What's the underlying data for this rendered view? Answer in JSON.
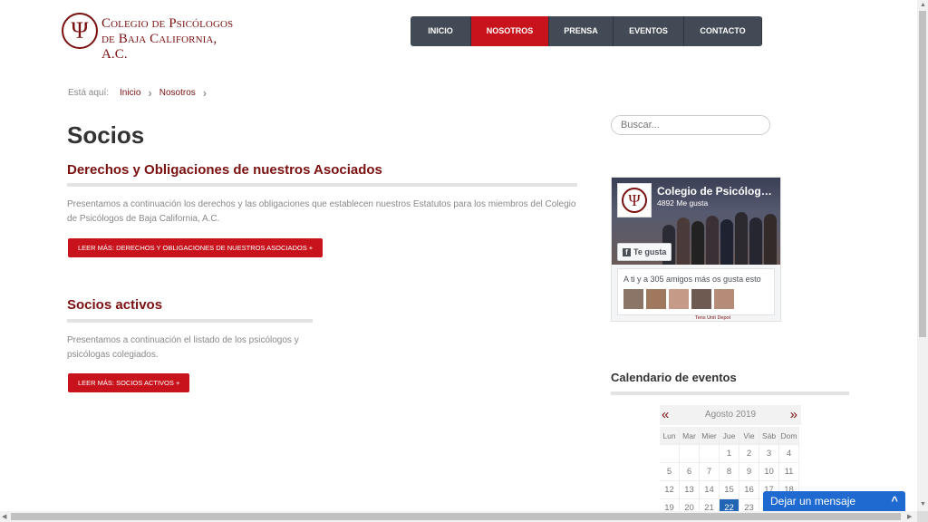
{
  "logo": {
    "mark": "Ψ",
    "line1": "Colegio de Psicólogos",
    "line2": "de Baja California, A.C."
  },
  "nav": [
    {
      "label": "INICIO",
      "active": false
    },
    {
      "label": "NOSOTROS",
      "active": true
    },
    {
      "label": "PRENSA",
      "active": false
    },
    {
      "label": "EVENTOS",
      "active": false
    },
    {
      "label": "CONTACTO",
      "active": false
    }
  ],
  "breadcrumb": {
    "prefix": "Está aquí:",
    "items": [
      "Inicio",
      "Nosotros"
    ]
  },
  "page_title": "Socios",
  "sections": [
    {
      "title": "Derechos y Obligaciones de nuestros Asociados",
      "text": "Presentamos a continuación los derechos y las obligaciones que establecen nuestros Estatutos para los miembros del Colegio de Psicólogos de Baja California, A.C.",
      "button": "LEER MÁS: DERECHOS Y OBLIGACIONES DE NUESTROS ASOCIADOS +"
    },
    {
      "title": "Socios activos",
      "text": "Presentamos a continuación el listado de los psicólogos y psicólogas colegiados.",
      "button": "LEER MÁS: SOCIOS ACTIVOS +"
    }
  ],
  "search": {
    "placeholder": "Buscar..."
  },
  "facebook": {
    "page_name": "Colegio de Psicólogos de Baja California",
    "likes": "4892 Me gusta",
    "like_button": "Te gusta",
    "friends_text": "A ti y a 305 amigos más os gusta esto",
    "footer": "Tens Unit Depot"
  },
  "calendar": {
    "title": "Calendario de eventos",
    "prev": "«",
    "next": "»",
    "month": "Agosto 2019",
    "weekdays": [
      "Lun",
      "Mar",
      "Mier",
      "Jue",
      "Vie",
      "Sáb",
      "Dom"
    ],
    "weeks": [
      [
        "",
        "",
        "",
        "1",
        "2",
        "3",
        "4"
      ],
      [
        "5",
        "6",
        "7",
        "8",
        "9",
        "10",
        "11"
      ],
      [
        "12",
        "13",
        "14",
        "15",
        "16",
        "17",
        "18"
      ],
      [
        "19",
        "20",
        "21",
        "22",
        "23",
        "",
        ""
      ]
    ],
    "today": "22"
  },
  "chat": {
    "label": "Dejar un mensaje",
    "caret": "^"
  },
  "colors": {
    "brand": "#7a1010",
    "accent": "#c8131c",
    "nav_bg": "#424b55",
    "chat": "#1e6ad1"
  }
}
